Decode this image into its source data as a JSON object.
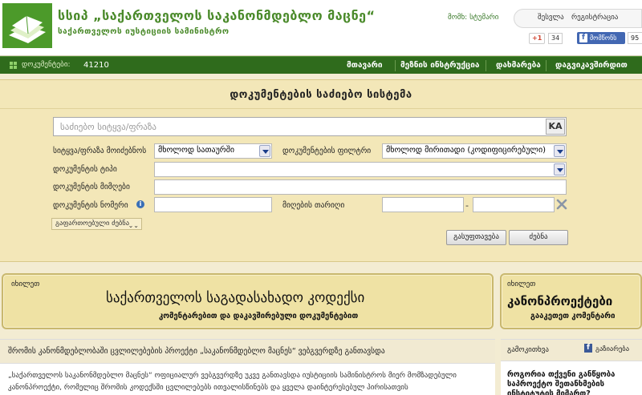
{
  "header": {
    "title": "სსიპ „საქართველოს საკანონმდებლო მაცნე“",
    "subtitle": "საქართველოს იუსტიციის სამინისტრო",
    "user_label": "მომხ: სტუმარი",
    "login": "შესვლა",
    "register": "რეგისტრაცია",
    "gplus_label": "+1",
    "gplus_count": "34",
    "fb_like_label": "მომწონს",
    "fb_like_count": "95"
  },
  "navbar": {
    "doc_count_label": "დოკუმენტები:",
    "doc_count_value": "41210",
    "items": [
      "მთავარი",
      "მეზნის ინსტრუქცია",
      "დახმარება",
      "დაგვიკავშირდით"
    ]
  },
  "search": {
    "title": "დოკუმენტების საძიებო სისტემა",
    "keyword_placeholder": "საძიებო სიტყვა/ფრაზა",
    "ka_button": "KA",
    "word_search_label": "სიტყვა/ფრაზა მოიძებნოს",
    "word_search_value": "მხოლოდ სათაურში",
    "doc_filter_label": "დოკუმენტების ფილტრი",
    "doc_filter_value": "მხოლოდ მირითადი (კოდიფიცირებული)",
    "doc_type_label": "დოკუმენტის ტიპი",
    "doc_type_value": "",
    "doc_issuer_label": "დოკუმენტის მიმღები",
    "doc_number_label": "დოკუმენტის ნომერი",
    "adoption_date_label": "მიღების თარიღი",
    "date_separator": "-",
    "advanced_label": "გაფართოებული ძებნა",
    "clear_button": "გასუფთავება",
    "search_button": "ძებნა"
  },
  "banners": {
    "left": {
      "small": "იხილეთ",
      "big": "საქართველოს საგადასახადო კოდექსი",
      "sub": "კომენტარებით და დაკავშირებული დოკუმენტებით"
    },
    "right": {
      "small": "იხილეთ",
      "big": "კანონპროექტები",
      "sub": "გააკეთეთ კომენტარი"
    }
  },
  "article": {
    "title": "შრომის კანონმდებლობაში ცვლილებების პროექტი „საკანონმდებლო მაცნეს“ ვებგვერდზე განთავსდა",
    "body": "„საქართველოს საკანონმდებლო მაცნეს“ ოფიციალურ ვებგვერდზე უკვე განთავსდა იუსტიციის სამინისტროს მიერ მომზადებული კანონპროექტი, რომელიც შრომის კოდექსში ცვლილებებს ითვალისწინებს და ყველა დაინტერესებულ პირისათვის"
  },
  "sidebar": {
    "label": "გამოკითხვა",
    "fb_label": "გაზიარება",
    "question": "როგორია თქვენი განწყობა საპროექტო შეთანხმების ინსტიტუტის მიმართ?"
  },
  "colors": {
    "brand_green": "#4a8a2a",
    "nav_green": "#2f6b1c",
    "panel_bg": "#f3e7b8"
  }
}
